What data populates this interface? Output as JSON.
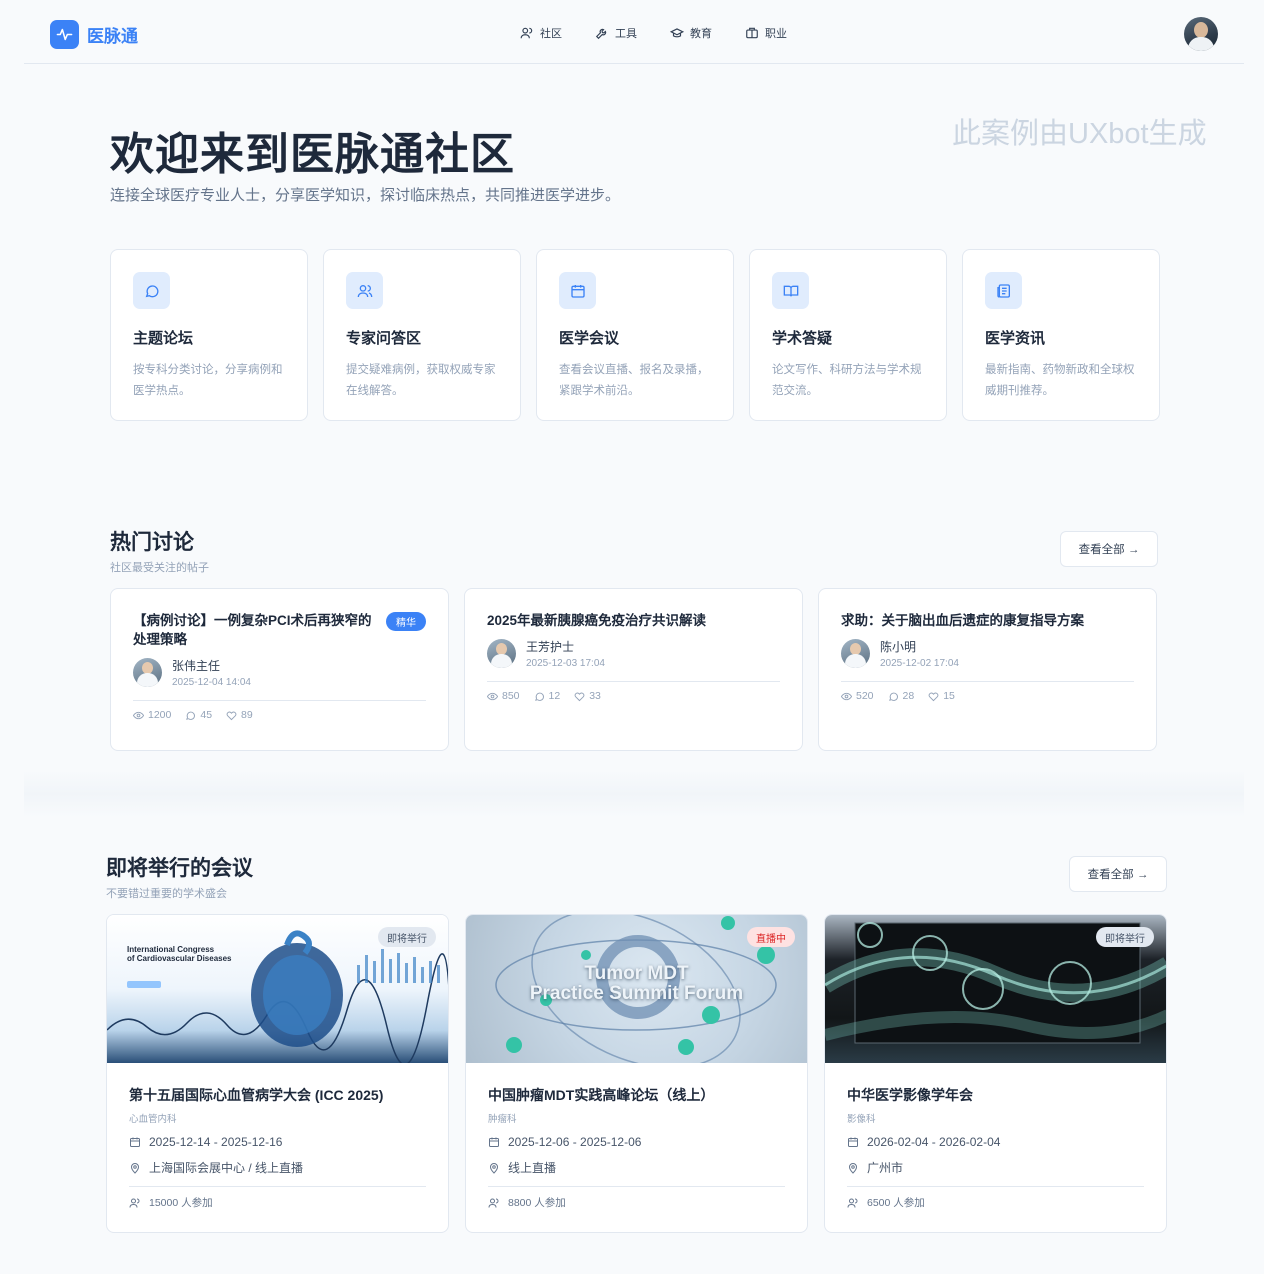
{
  "brand": {
    "name": "医脉通",
    "accent": "#3b82f6"
  },
  "nav": [
    {
      "label": "社区",
      "icon": "users-icon"
    },
    {
      "label": "工具",
      "icon": "wrench-icon"
    },
    {
      "label": "教育",
      "icon": "graduation-cap-icon"
    },
    {
      "label": "职业",
      "icon": "briefcase-icon"
    }
  ],
  "hero": {
    "title": "欢迎来到医脉通社区",
    "subtitle": "连接全球医疗专业人士，分享医学知识，探讨临床热点，共同推进医学进步。",
    "watermark": "此案例由UXbot生成"
  },
  "features": [
    {
      "title": "主题论坛",
      "desc": "按专科分类讨论，分享病例和医学热点。",
      "icon": "chat-bubble-icon"
    },
    {
      "title": "专家问答区",
      "desc": "提交疑难病例，获取权威专家在线解答。",
      "icon": "users-icon"
    },
    {
      "title": "医学会议",
      "desc": "查看会议直播、报名及录播，紧跟学术前沿。",
      "icon": "calendar-icon"
    },
    {
      "title": "学术答疑",
      "desc": "论文写作、科研方法与学术规范交流。",
      "icon": "book-open-icon"
    },
    {
      "title": "医学资讯",
      "desc": "最新指南、药物新政和全球权威期刊推荐。",
      "icon": "newspaper-icon"
    }
  ],
  "discussions": {
    "title": "热门讨论",
    "subtitle": "社区最受关注的帖子",
    "view_all": "查看全部 →",
    "items": [
      {
        "title": "【病例讨论】一例复杂PCI术后再狭窄的处理策略",
        "badge": "精华",
        "author": "张伟主任",
        "time": "2025-12-04 14:04",
        "views": "1200",
        "comments": "45",
        "likes": "89"
      },
      {
        "title": "2025年最新胰腺癌免疫治疗共识解读",
        "badge": "",
        "author": "王芳护士",
        "time": "2025-12-03 17:04",
        "views": "850",
        "comments": "12",
        "likes": "33"
      },
      {
        "title": "求助：关于脑出血后遗症的康复指导方案",
        "badge": "",
        "author": "陈小明",
        "time": "2025-12-02 17:04",
        "views": "520",
        "comments": "28",
        "likes": "15"
      }
    ]
  },
  "conferences": {
    "title": "即将举行的会议",
    "subtitle": "不要错过重要的学术盛会",
    "view_all": "查看全部 →",
    "items": [
      {
        "title": "第十五届国际心血管病学大会 (ICC 2025)",
        "category": "心血管内科",
        "dates": "2025-12-14 - 2025-12-16",
        "location": "上海国际会展中心 / 线上直播",
        "participants": "15000 人参加",
        "status": "即将举行",
        "image_text_line1": "International Congress",
        "image_text_line2": "of Cardiovascular Diseases"
      },
      {
        "title": "中国肿瘤MDT实践高峰论坛（线上）",
        "category": "肿瘤科",
        "dates": "2025-12-06 - 2025-12-06",
        "location": "线上直播",
        "participants": "8800 人参加",
        "status": "直播中",
        "image_text_line1": "Tumor MDT",
        "image_text_line2": "Practice Summit Forum"
      },
      {
        "title": "中华医学影像学年会",
        "category": "影像科",
        "dates": "2026-02-04 - 2026-02-04",
        "location": "广州市",
        "participants": "6500 人参加",
        "status": "即将举行"
      }
    ]
  }
}
